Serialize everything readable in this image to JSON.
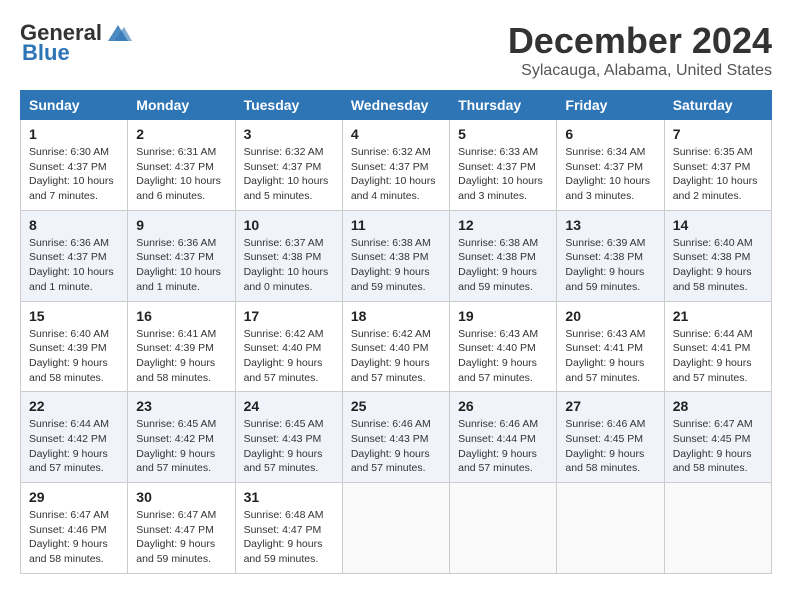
{
  "header": {
    "logo_general": "General",
    "logo_blue": "Blue",
    "title": "December 2024",
    "location": "Sylacauga, Alabama, United States"
  },
  "weekdays": [
    "Sunday",
    "Monday",
    "Tuesday",
    "Wednesday",
    "Thursday",
    "Friday",
    "Saturday"
  ],
  "weeks": [
    [
      {
        "day": "1",
        "sunrise": "Sunrise: 6:30 AM",
        "sunset": "Sunset: 4:37 PM",
        "daylight": "Daylight: 10 hours and 7 minutes."
      },
      {
        "day": "2",
        "sunrise": "Sunrise: 6:31 AM",
        "sunset": "Sunset: 4:37 PM",
        "daylight": "Daylight: 10 hours and 6 minutes."
      },
      {
        "day": "3",
        "sunrise": "Sunrise: 6:32 AM",
        "sunset": "Sunset: 4:37 PM",
        "daylight": "Daylight: 10 hours and 5 minutes."
      },
      {
        "day": "4",
        "sunrise": "Sunrise: 6:32 AM",
        "sunset": "Sunset: 4:37 PM",
        "daylight": "Daylight: 10 hours and 4 minutes."
      },
      {
        "day": "5",
        "sunrise": "Sunrise: 6:33 AM",
        "sunset": "Sunset: 4:37 PM",
        "daylight": "Daylight: 10 hours and 3 minutes."
      },
      {
        "day": "6",
        "sunrise": "Sunrise: 6:34 AM",
        "sunset": "Sunset: 4:37 PM",
        "daylight": "Daylight: 10 hours and 3 minutes."
      },
      {
        "day": "7",
        "sunrise": "Sunrise: 6:35 AM",
        "sunset": "Sunset: 4:37 PM",
        "daylight": "Daylight: 10 hours and 2 minutes."
      }
    ],
    [
      {
        "day": "8",
        "sunrise": "Sunrise: 6:36 AM",
        "sunset": "Sunset: 4:37 PM",
        "daylight": "Daylight: 10 hours and 1 minute."
      },
      {
        "day": "9",
        "sunrise": "Sunrise: 6:36 AM",
        "sunset": "Sunset: 4:37 PM",
        "daylight": "Daylight: 10 hours and 1 minute."
      },
      {
        "day": "10",
        "sunrise": "Sunrise: 6:37 AM",
        "sunset": "Sunset: 4:38 PM",
        "daylight": "Daylight: 10 hours and 0 minutes."
      },
      {
        "day": "11",
        "sunrise": "Sunrise: 6:38 AM",
        "sunset": "Sunset: 4:38 PM",
        "daylight": "Daylight: 9 hours and 59 minutes."
      },
      {
        "day": "12",
        "sunrise": "Sunrise: 6:38 AM",
        "sunset": "Sunset: 4:38 PM",
        "daylight": "Daylight: 9 hours and 59 minutes."
      },
      {
        "day": "13",
        "sunrise": "Sunrise: 6:39 AM",
        "sunset": "Sunset: 4:38 PM",
        "daylight": "Daylight: 9 hours and 59 minutes."
      },
      {
        "day": "14",
        "sunrise": "Sunrise: 6:40 AM",
        "sunset": "Sunset: 4:38 PM",
        "daylight": "Daylight: 9 hours and 58 minutes."
      }
    ],
    [
      {
        "day": "15",
        "sunrise": "Sunrise: 6:40 AM",
        "sunset": "Sunset: 4:39 PM",
        "daylight": "Daylight: 9 hours and 58 minutes."
      },
      {
        "day": "16",
        "sunrise": "Sunrise: 6:41 AM",
        "sunset": "Sunset: 4:39 PM",
        "daylight": "Daylight: 9 hours and 58 minutes."
      },
      {
        "day": "17",
        "sunrise": "Sunrise: 6:42 AM",
        "sunset": "Sunset: 4:40 PM",
        "daylight": "Daylight: 9 hours and 57 minutes."
      },
      {
        "day": "18",
        "sunrise": "Sunrise: 6:42 AM",
        "sunset": "Sunset: 4:40 PM",
        "daylight": "Daylight: 9 hours and 57 minutes."
      },
      {
        "day": "19",
        "sunrise": "Sunrise: 6:43 AM",
        "sunset": "Sunset: 4:40 PM",
        "daylight": "Daylight: 9 hours and 57 minutes."
      },
      {
        "day": "20",
        "sunrise": "Sunrise: 6:43 AM",
        "sunset": "Sunset: 4:41 PM",
        "daylight": "Daylight: 9 hours and 57 minutes."
      },
      {
        "day": "21",
        "sunrise": "Sunrise: 6:44 AM",
        "sunset": "Sunset: 4:41 PM",
        "daylight": "Daylight: 9 hours and 57 minutes."
      }
    ],
    [
      {
        "day": "22",
        "sunrise": "Sunrise: 6:44 AM",
        "sunset": "Sunset: 4:42 PM",
        "daylight": "Daylight: 9 hours and 57 minutes."
      },
      {
        "day": "23",
        "sunrise": "Sunrise: 6:45 AM",
        "sunset": "Sunset: 4:42 PM",
        "daylight": "Daylight: 9 hours and 57 minutes."
      },
      {
        "day": "24",
        "sunrise": "Sunrise: 6:45 AM",
        "sunset": "Sunset: 4:43 PM",
        "daylight": "Daylight: 9 hours and 57 minutes."
      },
      {
        "day": "25",
        "sunrise": "Sunrise: 6:46 AM",
        "sunset": "Sunset: 4:43 PM",
        "daylight": "Daylight: 9 hours and 57 minutes."
      },
      {
        "day": "26",
        "sunrise": "Sunrise: 6:46 AM",
        "sunset": "Sunset: 4:44 PM",
        "daylight": "Daylight: 9 hours and 57 minutes."
      },
      {
        "day": "27",
        "sunrise": "Sunrise: 6:46 AM",
        "sunset": "Sunset: 4:45 PM",
        "daylight": "Daylight: 9 hours and 58 minutes."
      },
      {
        "day": "28",
        "sunrise": "Sunrise: 6:47 AM",
        "sunset": "Sunset: 4:45 PM",
        "daylight": "Daylight: 9 hours and 58 minutes."
      }
    ],
    [
      {
        "day": "29",
        "sunrise": "Sunrise: 6:47 AM",
        "sunset": "Sunset: 4:46 PM",
        "daylight": "Daylight: 9 hours and 58 minutes."
      },
      {
        "day": "30",
        "sunrise": "Sunrise: 6:47 AM",
        "sunset": "Sunset: 4:47 PM",
        "daylight": "Daylight: 9 hours and 59 minutes."
      },
      {
        "day": "31",
        "sunrise": "Sunrise: 6:48 AM",
        "sunset": "Sunset: 4:47 PM",
        "daylight": "Daylight: 9 hours and 59 minutes."
      },
      null,
      null,
      null,
      null
    ]
  ]
}
